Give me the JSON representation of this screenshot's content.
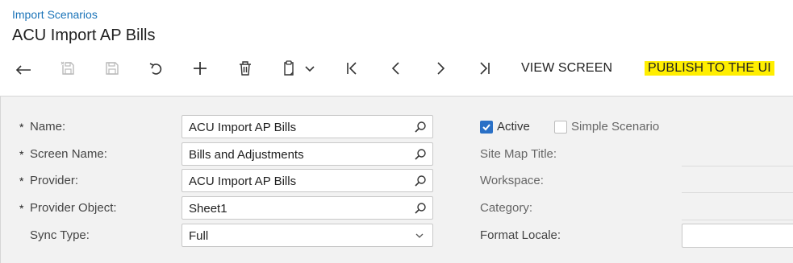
{
  "breadcrumb": "Import Scenarios",
  "title": "ACU Import AP Bills",
  "toolbar": {
    "buttons": [
      {
        "name": "back-button",
        "icon": "back-arrow-icon"
      },
      {
        "name": "save-close-button",
        "icon": "save-close-icon"
      },
      {
        "name": "save-button",
        "icon": "save-icon"
      },
      {
        "name": "cancel-button",
        "icon": "undo-icon"
      },
      {
        "name": "add-button",
        "icon": "plus-icon"
      },
      {
        "name": "delete-button",
        "icon": "trash-icon"
      },
      {
        "name": "copy-paste-button",
        "icon": "clipboard-icon"
      },
      {
        "name": "first-record-button",
        "icon": "first-icon"
      },
      {
        "name": "previous-record-button",
        "icon": "previous-icon"
      },
      {
        "name": "next-record-button",
        "icon": "next-icon"
      },
      {
        "name": "last-record-button",
        "icon": "last-icon"
      }
    ],
    "view_screen": "VIEW SCREEN",
    "publish": "PUBLISH TO THE UI",
    "highlight_color": "#ffee00"
  },
  "form": {
    "required_marker": "*",
    "fields": [
      {
        "label": "Name:",
        "value": "ACU Import AP Bills",
        "required": true,
        "icon": "search-icon"
      },
      {
        "label": "Screen Name:",
        "value": "Bills and Adjustments",
        "required": true,
        "icon": "search-icon"
      },
      {
        "label": "Provider:",
        "value": "ACU Import AP Bills",
        "required": true,
        "icon": "search-icon"
      },
      {
        "label": "Provider Object:",
        "value": "Sheet1",
        "required": true,
        "icon": "search-icon"
      },
      {
        "label": "Sync Type:",
        "value": "Full",
        "required": false,
        "icon": "chevron-down-icon"
      }
    ],
    "active": {
      "label": "Active",
      "checked": true
    },
    "simple_scenario": {
      "label": "Simple Scenario",
      "checked": false
    },
    "right_labels": {
      "site_map_title": "Site Map Title:",
      "workspace": "Workspace:",
      "category": "Category:",
      "format_locale": "Format Locale:"
    }
  },
  "colors": {
    "accent": "#2a70c6",
    "link": "#1a73b8",
    "panel_bg": "#f2f2f2"
  }
}
